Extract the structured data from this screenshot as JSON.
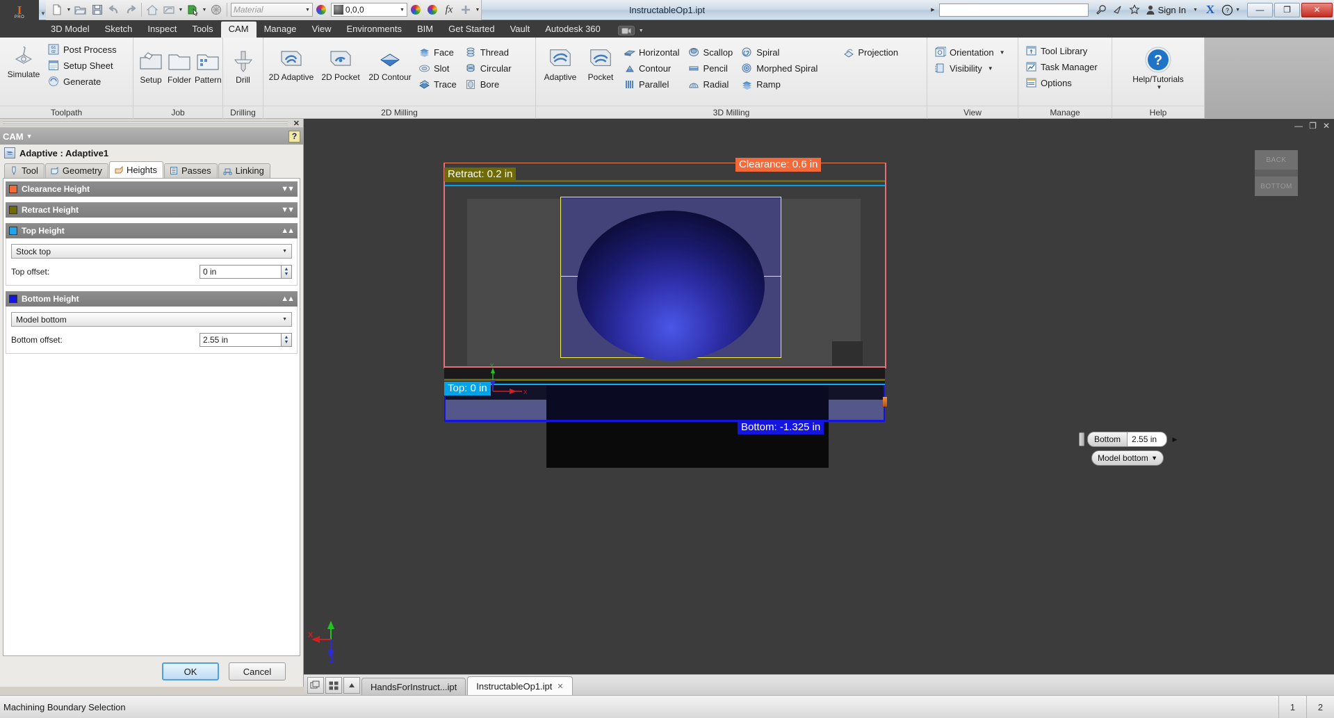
{
  "titlebar": {
    "document_title": "InstructableOp1.ipt",
    "material_placeholder": "Material",
    "appearance_value": "0,0,0",
    "sign_in_label": "Sign In",
    "search_value": "",
    "icons": [
      "new-document-icon",
      "open-folder-icon",
      "save-icon",
      "undo-icon",
      "redo-icon",
      "home-icon",
      "return-icon",
      "update-icon",
      "select-icon",
      "material-sphere-icon",
      "appearance-icon",
      "adjust-icon",
      "clear-icon",
      "fx-icon",
      "add-icon"
    ],
    "window_buttons": {
      "minimize": "—",
      "maximize": "❐",
      "close": "✕"
    },
    "right_icons": [
      "wrench-icon",
      "satellite-icon",
      "star-icon",
      "person-icon",
      "exchange-icon",
      "help-icon"
    ]
  },
  "ribbon_tabs": {
    "items": [
      "3D Model",
      "Sketch",
      "Inspect",
      "Tools",
      "CAM",
      "Manage",
      "View",
      "Environments",
      "BIM",
      "Get Started",
      "Vault",
      "Autodesk 360"
    ],
    "active": "CAM"
  },
  "ribbon": {
    "groups": [
      {
        "name": "Toolpath",
        "caption": "Toolpath",
        "big": [
          {
            "label": "Simulate",
            "icon": "simulate-icon"
          }
        ],
        "small": [
          {
            "label": "Post Process",
            "icon": "post-process-icon"
          },
          {
            "label": "Setup Sheet",
            "icon": "setup-sheet-icon"
          },
          {
            "label": "Generate",
            "icon": "generate-icon"
          }
        ]
      },
      {
        "name": "Job",
        "caption": "Job",
        "big": [
          {
            "label": "Setup",
            "icon": "setup-icon"
          },
          {
            "label": "Folder",
            "icon": "folder-icon"
          },
          {
            "label": "Pattern",
            "icon": "pattern-icon"
          }
        ],
        "small": []
      },
      {
        "name": "Drilling",
        "caption": "Drilling",
        "big": [
          {
            "label": "Drill",
            "icon": "drill-icon"
          }
        ],
        "small": []
      },
      {
        "name": "2D Milling",
        "caption": "2D Milling",
        "big": [
          {
            "label": "2D Adaptive",
            "icon": "adaptive-2d-icon"
          },
          {
            "label": "2D Pocket",
            "icon": "pocket-2d-icon"
          },
          {
            "label": "2D Contour",
            "icon": "contour-2d-icon"
          }
        ],
        "small": [
          {
            "label": "Face",
            "icon": "face-icon"
          },
          {
            "label": "Slot",
            "icon": "slot-icon"
          },
          {
            "label": "Trace",
            "icon": "trace-icon"
          },
          {
            "label": "Thread",
            "icon": "thread-icon"
          },
          {
            "label": "Circular",
            "icon": "circular-icon"
          },
          {
            "label": "Bore",
            "icon": "bore-icon"
          }
        ]
      },
      {
        "name": "3D Milling",
        "caption": "3D Milling",
        "big": [
          {
            "label": "Adaptive",
            "icon": "adaptive-icon"
          },
          {
            "label": "Pocket",
            "icon": "pocket-icon"
          }
        ],
        "small": [
          {
            "label": "Horizontal",
            "icon": "horizontal-icon"
          },
          {
            "label": "Contour",
            "icon": "contour-icon"
          },
          {
            "label": "Parallel",
            "icon": "parallel-icon"
          },
          {
            "label": "Scallop",
            "icon": "scallop-icon"
          },
          {
            "label": "Pencil",
            "icon": "pencil-icon"
          },
          {
            "label": "Radial",
            "icon": "radial-icon"
          },
          {
            "label": "Spiral",
            "icon": "spiral-icon"
          },
          {
            "label": "Morphed Spiral",
            "icon": "morphed-spiral-icon"
          },
          {
            "label": "Ramp",
            "icon": "ramp-icon"
          },
          {
            "label": "Projection",
            "icon": "projection-icon"
          }
        ]
      },
      {
        "name": "View",
        "caption": "View",
        "big": [],
        "small": [
          {
            "label": "Orientation",
            "icon": "orientation-icon",
            "dropdown": true
          },
          {
            "label": "Visibility",
            "icon": "visibility-icon",
            "dropdown": true
          }
        ]
      },
      {
        "name": "Manage",
        "caption": "Manage",
        "big": [],
        "small": [
          {
            "label": "Tool Library",
            "icon": "tool-library-icon"
          },
          {
            "label": "Task Manager",
            "icon": "task-manager-icon"
          },
          {
            "label": "Options",
            "icon": "options-icon"
          }
        ]
      },
      {
        "name": "Help",
        "caption": "Help",
        "big": [
          {
            "label": "Help/Tutorials",
            "icon": "help-icon"
          }
        ],
        "small": []
      }
    ]
  },
  "cam_panel": {
    "title": "CAM",
    "help_icon": "help-question-icon",
    "close_icon": "close-icon",
    "operation_label": "Adaptive : Adaptive1",
    "operation_icon": "adaptive-operation-icon",
    "tabs": [
      {
        "label": "Tool",
        "icon": "tool-icon",
        "active": false
      },
      {
        "label": "Geometry",
        "icon": "geometry-icon",
        "active": false
      },
      {
        "label": "Heights",
        "icon": "heights-icon",
        "active": true
      },
      {
        "label": "Passes",
        "icon": "passes-icon",
        "active": false
      },
      {
        "label": "Linking",
        "icon": "linking-icon",
        "active": false
      }
    ],
    "sections": [
      {
        "title": "Clearance Height",
        "color": "#f4693a",
        "expanded": false,
        "chevron": "»"
      },
      {
        "title": "Retract Height",
        "color": "#6e6b06",
        "expanded": false,
        "chevron": "»"
      },
      {
        "title": "Top Height",
        "color": "#1ea5ef",
        "expanded": true,
        "chevron": "«",
        "from_label": "Stock top",
        "offset_label": "Top offset:",
        "offset_value": "0 in"
      },
      {
        "title": "Bottom Height",
        "color": "#1515e0",
        "expanded": true,
        "chevron": "«",
        "from_label": "Model bottom",
        "offset_label": "Bottom offset:",
        "offset_value": "2.55 in"
      }
    ],
    "ok_label": "OK",
    "cancel_label": "Cancel"
  },
  "viewport": {
    "viewcube": {
      "back": "BACK",
      "bottom": "BOTTOM"
    },
    "window_buttons": {
      "minimize": "—",
      "restore": "❐",
      "close": "✕"
    },
    "annotations": [
      {
        "name": "clearance-label",
        "text": "Clearance: 0.6 in",
        "color": "#f4693a"
      },
      {
        "name": "retract-label",
        "text": "Retract: 0.2 in",
        "color": "#6e6b06"
      },
      {
        "name": "top-label",
        "text": "Top: 0 in",
        "color": "#00a2e8"
      },
      {
        "name": "bottom-label",
        "text": "Bottom: -1.325 in",
        "color": "#1515e0"
      }
    ],
    "float_edit": {
      "label": "Bottom",
      "value": "2.55 in",
      "arrow": "▶",
      "dropdown_value": "Model bottom",
      "dropdown_caret": "▼"
    },
    "axis_triad": {
      "x": "X",
      "y": "Y",
      "z": "Z"
    },
    "origin_triad": {
      "x": "X",
      "y": "Y",
      "z": "Z"
    }
  },
  "doc_tabs": {
    "icons": [
      "tile-windows-icon",
      "arrange-icon",
      "scroll-up-icon"
    ],
    "tabs": [
      {
        "label": "HandsForInstruct...ipt",
        "active": false,
        "close": ""
      },
      {
        "label": "InstructableOp1.ipt",
        "active": true,
        "close": "✕"
      }
    ]
  },
  "statusbar": {
    "message": "Machining Boundary Selection",
    "cells": [
      "1",
      "2"
    ]
  }
}
